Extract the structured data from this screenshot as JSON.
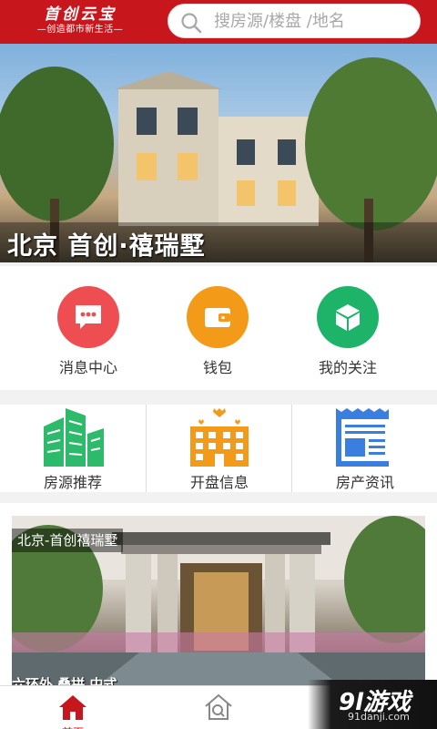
{
  "header": {
    "logo_main": "首创云宝",
    "logo_sub": "—创造都市新生活—",
    "search_placeholder": "搜房源/楼盘 /地名"
  },
  "banner": {
    "title": "北京 首创·禧瑞墅"
  },
  "circle_nav": [
    {
      "label": "消息中心",
      "icon": "message-icon",
      "color": "#ee4e51"
    },
    {
      "label": "钱包",
      "icon": "wallet-icon",
      "color": "#f39a19"
    },
    {
      "label": "我的关注",
      "icon": "cube-icon",
      "color": "#1db46a"
    }
  ],
  "square_nav": [
    {
      "label": "房源推荐",
      "icon": "buildings-icon",
      "color": "#2dbb6b"
    },
    {
      "label": "开盘信息",
      "icon": "apartment-icon",
      "color": "#f39a19"
    },
    {
      "label": "房产资讯",
      "icon": "newspaper-icon",
      "color": "#3a7ee0"
    }
  ],
  "card": {
    "title": "北京-首创禧瑞墅",
    "subtitle": "六环外 叠拼 中式"
  },
  "bottom_nav": [
    {
      "label": "首页",
      "icon": "home-icon",
      "active": true
    },
    {
      "label": "",
      "icon": "house-search-icon",
      "active": false
    }
  ],
  "watermark": {
    "main": "9l游戏",
    "sub": "91danji.com"
  }
}
